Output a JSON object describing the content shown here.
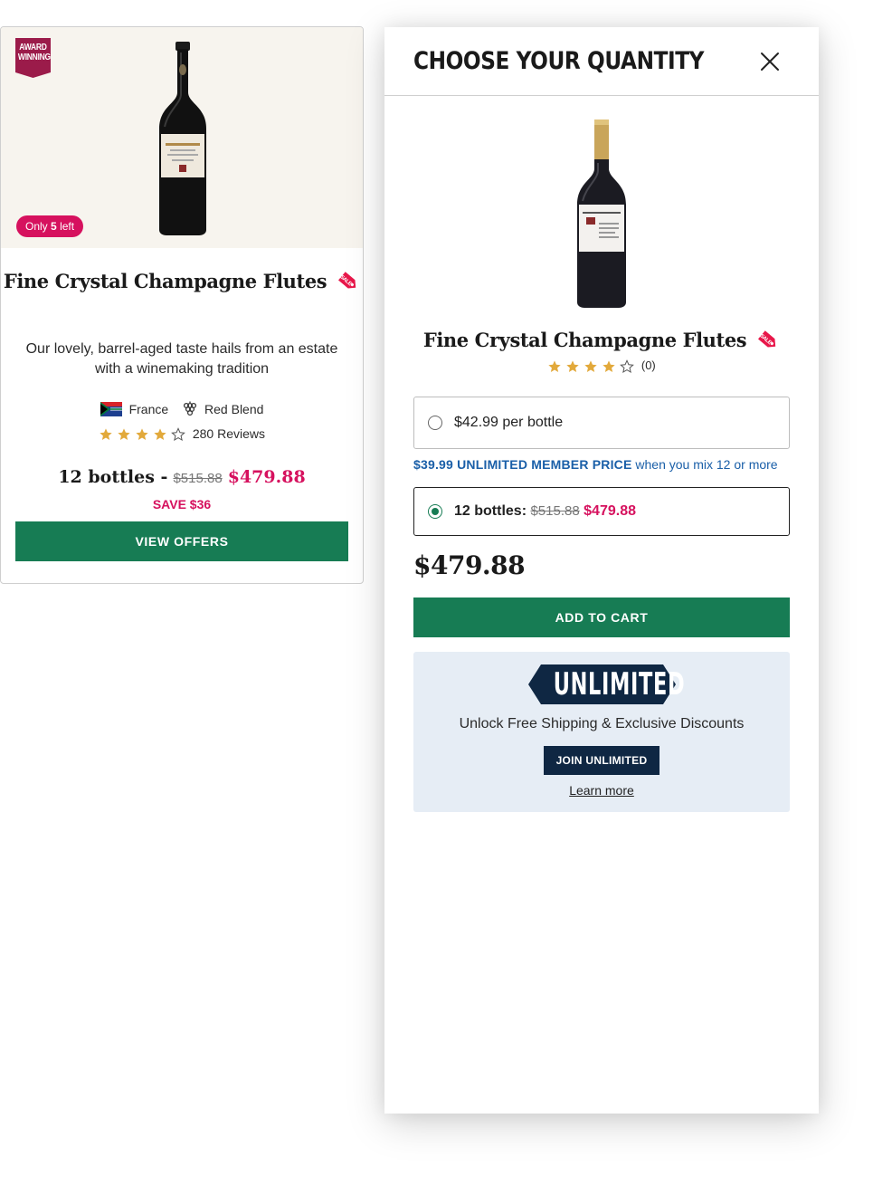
{
  "colors": {
    "accent_green": "#177c54",
    "sale_red": "#d6115e",
    "member_blue": "#1a5fa8",
    "navy": "#0f2743",
    "star_gold": "#e2a93b"
  },
  "card": {
    "award_line1": "AWARD",
    "award_line2": "WINNING",
    "stock_prefix": "Only",
    "stock_count": "5",
    "stock_suffix": "left",
    "title": "Fine Crystal Champagne Flutes",
    "sale_icon": "sale-tag-icon",
    "description": "Our lovely, barrel-aged taste hails from an estate with a winemaking tradition",
    "country": "France",
    "country_icon": "flag-icon",
    "varietal": "Red Blend",
    "varietal_icon": "grape-icon",
    "rating": 4,
    "rating_max": 5,
    "reviews": "280 Reviews",
    "qty_label": "12 bottles -",
    "was_price": "$515.88",
    "sale_price": "$479.88",
    "save": "SAVE $36",
    "cta": "VIEW OFFERS"
  },
  "modal": {
    "title": "CHOOSE YOUR QUANTITY",
    "close_icon": "close-icon",
    "product_name": "Fine Crystal Champagne Flutes",
    "rating": 4,
    "rating_max": 5,
    "rating_count": "(0)",
    "option_single": "$42.99 per bottle",
    "member_price": "$39.99 UNLIMITED MEMBER PRICE",
    "member_note": "when you mix 12 or more",
    "option_case_label": "12 bottles:",
    "option_case_was": "$515.88",
    "option_case_price": "$479.88",
    "selected_option": "12 bottles",
    "total": "$479.88",
    "cta": "ADD TO CART",
    "unlimited": {
      "logo": "UNLIMITED",
      "text": "Unlock Free Shipping & Exclusive Discounts",
      "join": "JOIN UNLIMITED",
      "learn": "Learn more"
    }
  }
}
